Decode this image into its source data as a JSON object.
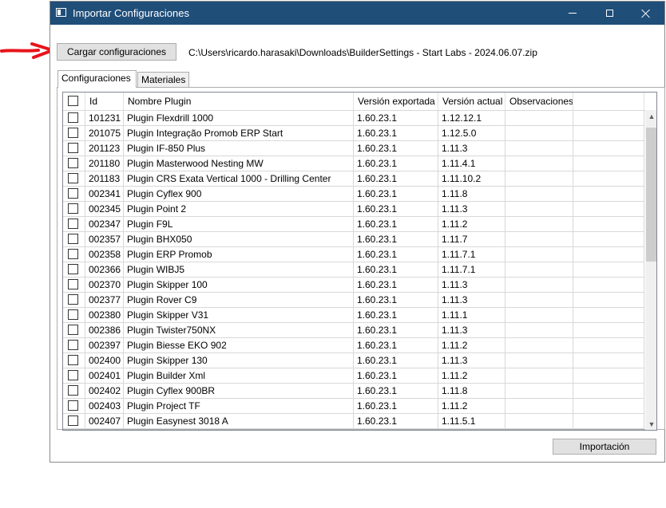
{
  "window": {
    "title": "Importar Configuraciones"
  },
  "toolbar": {
    "load_label": "Cargar configuraciones",
    "file_path": "C:\\Users\\ricardo.harasaki\\Downloads\\BuilderSettings - Start Labs - 2024.06.07.zip"
  },
  "tabs": [
    {
      "label": "Configuraciones",
      "active": true
    },
    {
      "label": "Materiales",
      "active": false
    }
  ],
  "grid": {
    "columns": [
      "Id",
      "Nombre Plugin",
      "Versión exportada",
      "Versión actual",
      "Observaciones"
    ],
    "rows": [
      [
        "101231",
        "Plugin Flexdrill 1000",
        "1.60.23.1",
        "1.12.12.1",
        ""
      ],
      [
        "201075",
        "Plugin Integração Promob ERP Start",
        "1.60.23.1",
        "1.12.5.0",
        ""
      ],
      [
        "201123",
        "Plugin IF-850 Plus",
        "1.60.23.1",
        "1.11.3",
        ""
      ],
      [
        "201180",
        "Plugin Masterwood Nesting MW",
        "1.60.23.1",
        "1.11.4.1",
        ""
      ],
      [
        "201183",
        "Plugin CRS Exata Vertical 1000 - Drilling Center",
        "1.60.23.1",
        "1.11.10.2",
        ""
      ],
      [
        "002341",
        "Plugin Cyflex 900",
        "1.60.23.1",
        "1.11.8",
        ""
      ],
      [
        "002345",
        "Plugin Point 2",
        "1.60.23.1",
        "1.11.3",
        ""
      ],
      [
        "002347",
        "Plugin F9L",
        "1.60.23.1",
        "1.11.2",
        ""
      ],
      [
        "002357",
        "Plugin BHX050",
        "1.60.23.1",
        "1.11.7",
        ""
      ],
      [
        "002358",
        "Plugin ERP Promob",
        "1.60.23.1",
        "1.11.7.1",
        ""
      ],
      [
        "002366",
        "Plugin WIBJ5",
        "1.60.23.1",
        "1.11.7.1",
        ""
      ],
      [
        "002370",
        "Plugin Skipper 100",
        "1.60.23.1",
        "1.11.3",
        ""
      ],
      [
        "002377",
        "Plugin Rover C9",
        "1.60.23.1",
        "1.11.3",
        ""
      ],
      [
        "002380",
        "Plugin Skipper V31",
        "1.60.23.1",
        "1.11.1",
        ""
      ],
      [
        "002386",
        "Plugin Twister750NX",
        "1.60.23.1",
        "1.11.3",
        ""
      ],
      [
        "002397",
        "Plugin Biesse EKO 902",
        "1.60.23.1",
        "1.11.2",
        ""
      ],
      [
        "002400",
        "Plugin Skipper 130",
        "1.60.23.1",
        "1.11.3",
        ""
      ],
      [
        "002401",
        "Plugin Builder Xml",
        "1.60.23.1",
        "1.11.2",
        ""
      ],
      [
        "002402",
        "Plugin Cyflex 900BR",
        "1.60.23.1",
        "1.11.8",
        ""
      ],
      [
        "002403",
        "Plugin Project TF",
        "1.60.23.1",
        "1.11.2",
        ""
      ],
      [
        "002407",
        "Plugin Easynest 3018 A",
        "1.60.23.1",
        "1.11.5.1",
        ""
      ]
    ]
  },
  "footer": {
    "import_label": "Importación"
  },
  "colors": {
    "titlebar": "#1f4e79",
    "arrow": "#e8141c"
  }
}
